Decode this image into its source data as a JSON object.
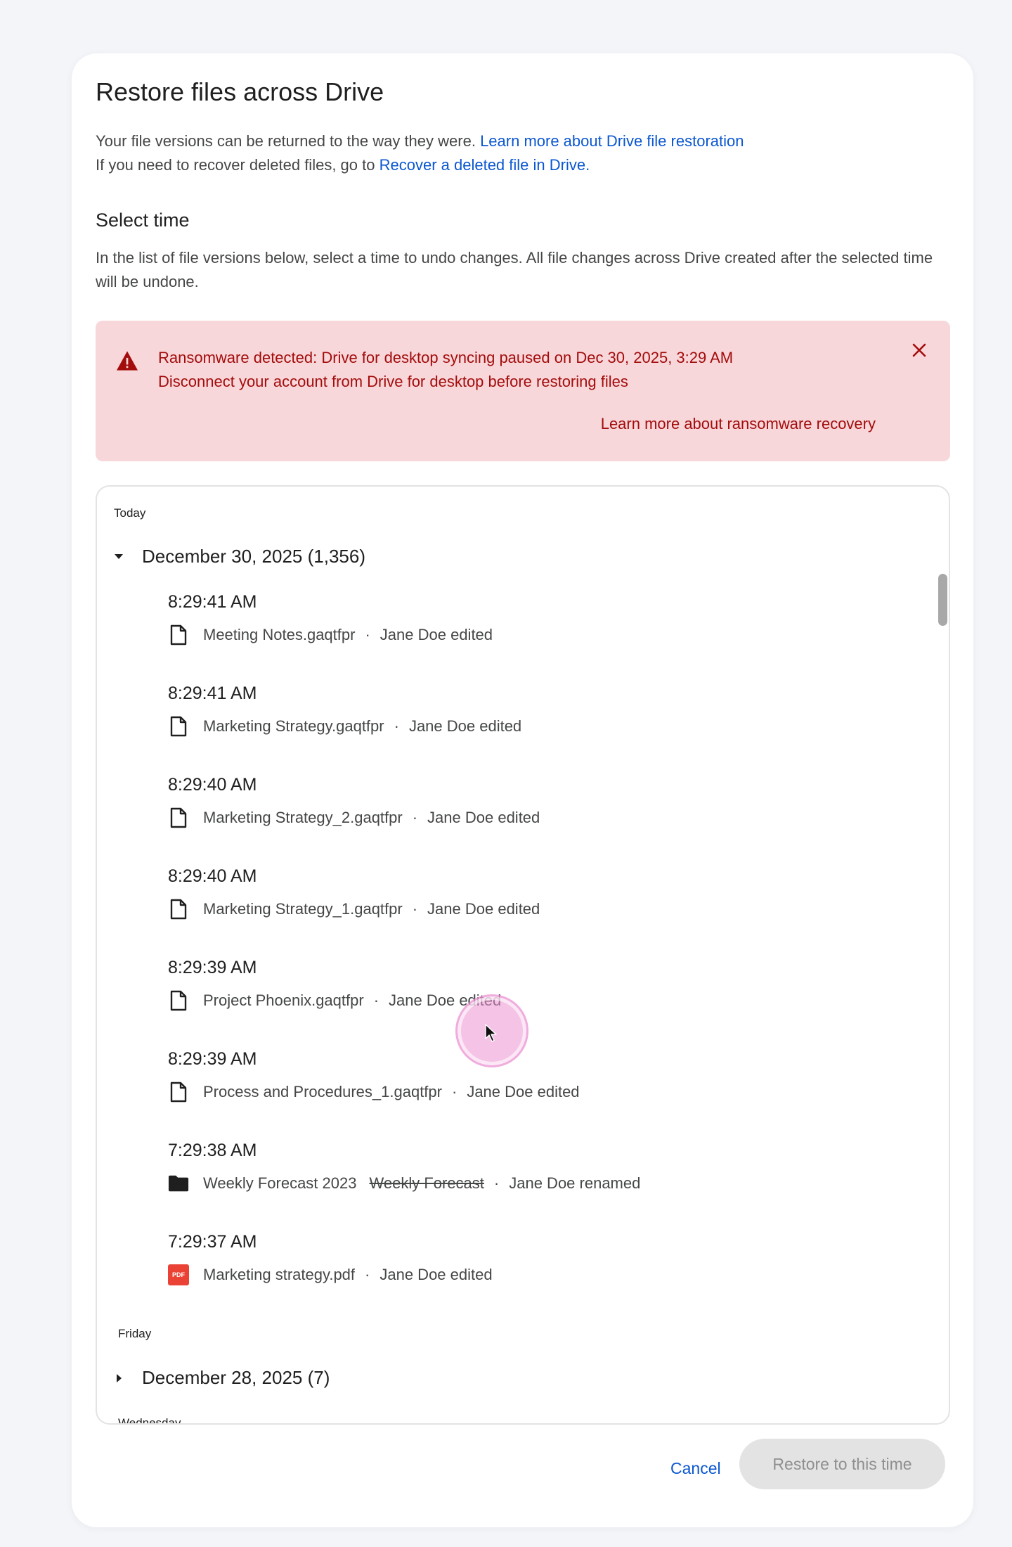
{
  "dialog": {
    "title": "Restore files across Drive",
    "desc_line1_text": "Your file versions can be returned to the way they were.",
    "desc_line1_link": "Learn more about Drive file restoration",
    "desc_line2_text": "If you need to recover deleted files, go to",
    "desc_line2_link": "Recover a deleted file in Drive."
  },
  "select_time": {
    "title": "Select time",
    "description": "In the list of file versions below, select a time to undo changes. All file changes across Drive created after the selected time will be undone."
  },
  "alert": {
    "title": "Ransomware detected: Drive for desktop syncing paused on Dec 30, 2025, 3:29 AM",
    "subtitle": "Disconnect your account from Drive for desktop before restoring files",
    "link": "Learn more about ransomware recovery",
    "color": "#a30c0c",
    "background": "#f8d7da"
  },
  "versions": {
    "groups": [
      {
        "day": "Today",
        "date": "December 30, 2025",
        "count": "(1,356)",
        "expanded": true,
        "entries": [
          {
            "time": "8:29:41 AM",
            "file": "Meeting Notes.gaqtfpr",
            "icon": "file-icon",
            "action": "Jane Doe edited"
          },
          {
            "time": "8:29:41 AM",
            "file": "Marketing Strategy.gaqtfpr",
            "icon": "file-icon",
            "action": "Jane Doe edited"
          },
          {
            "time": "8:29:40 AM",
            "file": "Marketing Strategy_2.gaqtfpr",
            "icon": "file-icon",
            "action": "Jane Doe edited"
          },
          {
            "time": "8:29:40 AM",
            "file": "Marketing Strategy_1.gaqtfpr",
            "icon": "file-icon",
            "action": "Jane Doe edited"
          },
          {
            "time": "8:29:39 AM",
            "file": "Project Phoenix.gaqtfpr",
            "icon": "file-icon",
            "action": "Jane Doe edited"
          },
          {
            "time": "8:29:39 AM",
            "file": "Process and Procedures_1.gaqtfpr",
            "icon": "file-icon",
            "action": "Jane Doe edited"
          },
          {
            "time": "7:29:38 AM",
            "file": "Weekly Forecast 2023",
            "old_name": "Weekly Forecast",
            "icon": "folder-icon",
            "action": "Jane Doe renamed"
          },
          {
            "time": "7:29:37 AM",
            "file": "Marketing strategy.pdf",
            "icon": "pdf-icon",
            "pdf_label": "PDF",
            "action": "Jane Doe edited"
          }
        ]
      },
      {
        "day": "Friday",
        "date": "December 28, 2025",
        "count": "(7)",
        "expanded": false
      },
      {
        "day": "Wednesday"
      }
    ],
    "separator": "·"
  },
  "footer": {
    "cancel_label": "Cancel",
    "restore_label": "Restore to this time"
  }
}
